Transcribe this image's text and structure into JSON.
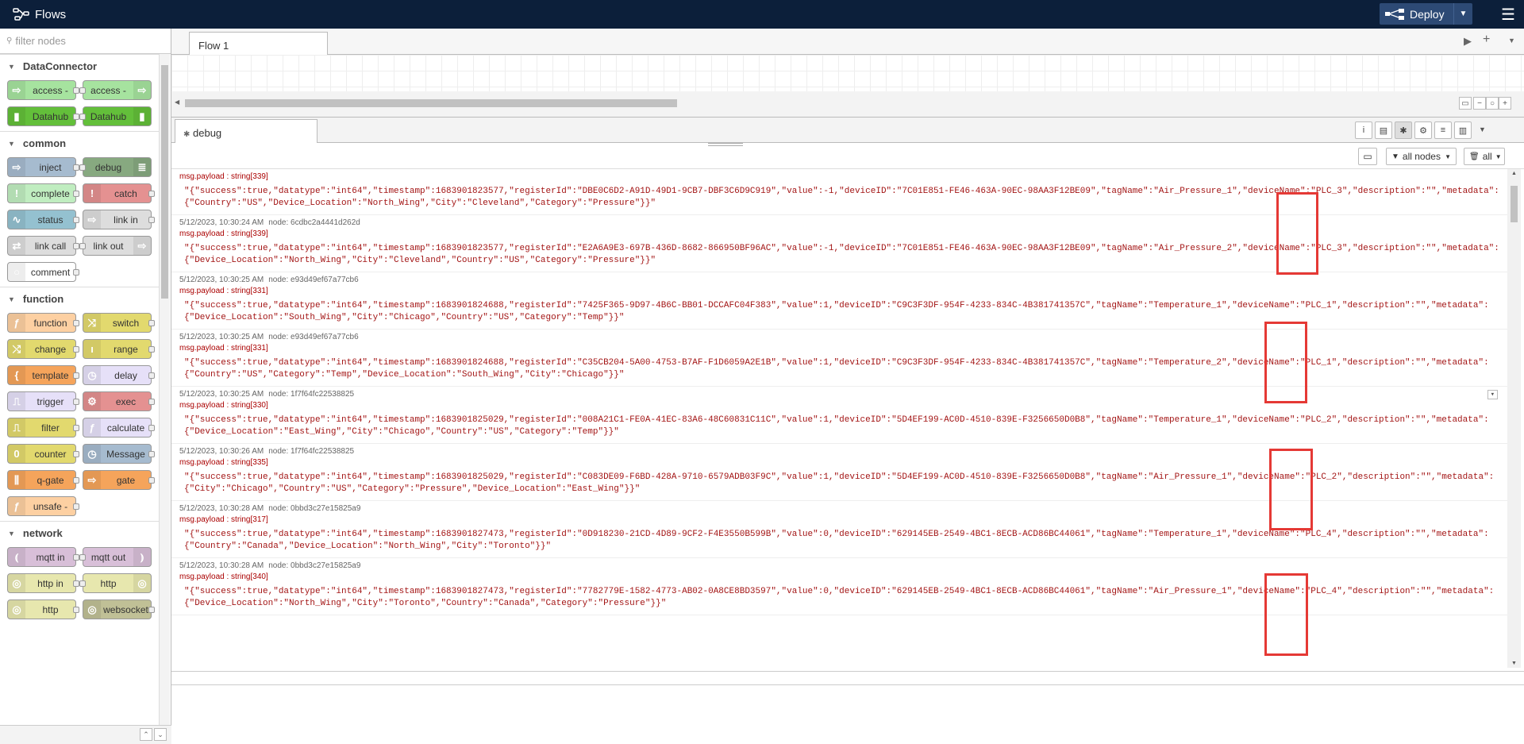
{
  "header": {
    "title": "Flows",
    "deploy_label": "Deploy"
  },
  "palette": {
    "search_placeholder": "filter nodes",
    "categories": [
      {
        "name": "DataConnector",
        "nodes": [
          {
            "label": "access -",
            "color": "#a6e39f",
            "icon": "⇨",
            "side": "l"
          },
          {
            "label": "access -",
            "color": "#a6e39f",
            "icon": "⇨",
            "side": "r"
          },
          {
            "label": "Datahub",
            "color": "#63bf3a",
            "icon": "▮",
            "side": "l"
          },
          {
            "label": "Datahub",
            "color": "#63bf3a",
            "icon": "▮",
            "side": "r"
          }
        ]
      },
      {
        "name": "common",
        "nodes": [
          {
            "label": "inject",
            "color": "#a6bbcf",
            "icon": "⇨",
            "side": "l"
          },
          {
            "label": "debug",
            "color": "#87a980",
            "icon": "≣",
            "side": "r"
          },
          {
            "label": "complete",
            "color": "#c0edc0",
            "icon": "!",
            "side": "l"
          },
          {
            "label": "catch",
            "color": "#e49191",
            "icon": "!",
            "side": "l"
          },
          {
            "label": "status",
            "color": "#94c1d0",
            "icon": "∿",
            "side": "l"
          },
          {
            "label": "link in",
            "color": "#dddddd",
            "icon": "⇨",
            "side": "l"
          },
          {
            "label": "link call",
            "color": "#dddddd",
            "icon": "⇄",
            "side": "l"
          },
          {
            "label": "link out",
            "color": "#dddddd",
            "icon": "⇨",
            "side": "r"
          },
          {
            "label": "comment",
            "color": "#ffffff",
            "icon": "○",
            "side": "l"
          }
        ]
      },
      {
        "name": "function",
        "nodes": [
          {
            "label": "function",
            "color": "#fdd0a2",
            "icon": "ƒ",
            "side": "l"
          },
          {
            "label": "switch",
            "color": "#e2d96e",
            "icon": "⤨",
            "side": "l"
          },
          {
            "label": "change",
            "color": "#e2d96e",
            "icon": "⤭",
            "side": "l"
          },
          {
            "label": "range",
            "color": "#e2d96e",
            "icon": "ı",
            "side": "l"
          },
          {
            "label": "template",
            "color": "#f5a45b",
            "icon": "{",
            "side": "l"
          },
          {
            "label": "delay",
            "color": "#e6e0f8",
            "icon": "◷",
            "side": "l"
          },
          {
            "label": "trigger",
            "color": "#e6e0f8",
            "icon": "⎍",
            "side": "l"
          },
          {
            "label": "exec",
            "color": "#e49191",
            "icon": "⚙",
            "side": "l"
          },
          {
            "label": "filter",
            "color": "#e2d96e",
            "icon": "⎍",
            "side": "l"
          },
          {
            "label": "calculate",
            "color": "#e6e0f8",
            "icon": "ƒ",
            "side": "l"
          },
          {
            "label": "counter",
            "color": "#e2d96e",
            "icon": "0",
            "side": "l"
          },
          {
            "label": "Message",
            "color": "#a6bbcf",
            "icon": "◷",
            "side": "l"
          },
          {
            "label": "q-gate",
            "color": "#f5a45b",
            "icon": "⫼",
            "side": "l"
          },
          {
            "label": "gate",
            "color": "#f5a45b",
            "icon": "⇨",
            "side": "l"
          },
          {
            "label": "unsafe -",
            "color": "#fdd0a2",
            "icon": "ƒ",
            "side": "l"
          }
        ]
      },
      {
        "name": "network",
        "nodes": [
          {
            "label": "mqtt in",
            "color": "#d8bfd8",
            "icon": "⦅",
            "side": "l"
          },
          {
            "label": "mqtt out",
            "color": "#d8bfd8",
            "icon": "⦆",
            "side": "r"
          },
          {
            "label": "http in",
            "color": "#e7e7ae",
            "icon": "◎",
            "side": "l"
          },
          {
            "label": "http",
            "color": "#e7e7ae",
            "icon": "◎",
            "side": "r"
          },
          {
            "label": "http",
            "color": "#e7e7ae",
            "icon": "◎",
            "side": "l"
          },
          {
            "label": "websocket",
            "color": "#c0c096",
            "icon": "◎",
            "side": "l"
          }
        ]
      }
    ]
  },
  "workspace": {
    "tabs": [
      {
        "label": "Flow 1"
      }
    ]
  },
  "sidebar": {
    "tab_label": "debug",
    "filter_label": "all nodes",
    "clear_label": "all"
  },
  "debug": {
    "messages": [
      {
        "time": "",
        "node": "",
        "topic": "msg.payload : string[339]",
        "line1": "\"{\"success\":true,\"datatype\":\"int64\",\"timestamp\":1683901823577,\"registerId\":\"DBE0C6D2-A91D-49D1-9CB7-DBF3C6D9C919\",\"value\":-1,\"deviceID\":\"7C01E851-FE46-463A-90EC-98AA3F12BE09\",\"tagName\":\"Air_Pressure_1\",\"deviceName\":\"PLC_3\",\"description\":\"\",\"metadata\":",
        "line2": "{\"Country\":\"US\",\"Device_Location\":\"North_Wing\",\"City\":\"Cleveland\",\"Category\":\"Pressure\"}}\""
      },
      {
        "time": "5/12/2023, 10:30:24 AM",
        "node": "node: 6cdbc2a4441d262d",
        "topic": "msg.payload : string[339]",
        "line1": "\"{\"success\":true,\"datatype\":\"int64\",\"timestamp\":1683901823577,\"registerId\":\"E2A6A9E3-697B-436D-8682-866950BF96AC\",\"value\":-1,\"deviceID\":\"7C01E851-FE46-463A-90EC-98AA3F12BE09\",\"tagName\":\"Air_Pressure_2\",\"deviceName\":\"PLC_3\",\"description\":\"\",\"metadata\":",
        "line2": "{\"Device_Location\":\"North_Wing\",\"City\":\"Cleveland\",\"Country\":\"US\",\"Category\":\"Pressure\"}}\""
      },
      {
        "time": "5/12/2023, 10:30:25 AM",
        "node": "node: e93d49ef67a77cb6",
        "topic": "msg.payload : string[331]",
        "line1": "\"{\"success\":true,\"datatype\":\"int64\",\"timestamp\":1683901824688,\"registerId\":\"7425F365-9D97-4B6C-BB01-DCCAFC04F383\",\"value\":1,\"deviceID\":\"C9C3F3DF-954F-4233-834C-4B381741357C\",\"tagName\":\"Temperature_1\",\"deviceName\":\"PLC_1\",\"description\":\"\",\"metadata\":",
        "line2": "{\"Device_Location\":\"South_Wing\",\"City\":\"Chicago\",\"Country\":\"US\",\"Category\":\"Temp\"}}\""
      },
      {
        "time": "5/12/2023, 10:30:25 AM",
        "node": "node: e93d49ef67a77cb6",
        "topic": "msg.payload : string[331]",
        "line1": "\"{\"success\":true,\"datatype\":\"int64\",\"timestamp\":1683901824688,\"registerId\":\"C35CB204-5A00-4753-B7AF-F1D6059A2E1B\",\"value\":1,\"deviceID\":\"C9C3F3DF-954F-4233-834C-4B381741357C\",\"tagName\":\"Temperature_2\",\"deviceName\":\"PLC_1\",\"description\":\"\",\"metadata\":",
        "line2": "{\"Country\":\"US\",\"Category\":\"Temp\",\"Device_Location\":\"South_Wing\",\"City\":\"Chicago\"}}\""
      },
      {
        "time": "5/12/2023, 10:30:25 AM",
        "node": "node: 1f7f64fc22538825",
        "topic": "msg.payload : string[330]",
        "line1": "\"{\"success\":true,\"datatype\":\"int64\",\"timestamp\":1683901825029,\"registerId\":\"008A21C1-FE0A-41EC-83A6-48C60831C11C\",\"value\":1,\"deviceID\":\"5D4EF199-AC0D-4510-839E-F3256650D0B8\",\"tagName\":\"Temperature_1\",\"deviceName\":\"PLC_2\",\"description\":\"\",\"metadata\":",
        "line2": "{\"Device_Location\":\"East_Wing\",\"City\":\"Chicago\",\"Country\":\"US\",\"Category\":\"Temp\"}}\""
      },
      {
        "time": "5/12/2023, 10:30:26 AM",
        "node": "node: 1f7f64fc22538825",
        "topic": "msg.payload : string[335]",
        "line1": "\"{\"success\":true,\"datatype\":\"int64\",\"timestamp\":1683901825029,\"registerId\":\"C083DE09-F6BD-428A-9710-6579ADB03F9C\",\"value\":1,\"deviceID\":\"5D4EF199-AC0D-4510-839E-F3256650D0B8\",\"tagName\":\"Air_Pressure_1\",\"deviceName\":\"PLC_2\",\"description\":\"\",\"metadata\":",
        "line2": "{\"City\":\"Chicago\",\"Country\":\"US\",\"Category\":\"Pressure\",\"Device_Location\":\"East_Wing\"}}\""
      },
      {
        "time": "5/12/2023, 10:30:28 AM",
        "node": "node: 0bbd3c27e15825a9",
        "topic": "msg.payload : string[317]",
        "line1": "\"{\"success\":true,\"datatype\":\"int64\",\"timestamp\":1683901827473,\"registerId\":\"0D918230-21CD-4D89-9CF2-F4E3550B599B\",\"value\":0,\"deviceID\":\"629145EB-2549-4BC1-8ECB-ACD86BC44061\",\"tagName\":\"Temperature_1\",\"deviceName\":\"PLC_4\",\"description\":\"\",\"metadata\":",
        "line2": "{\"Country\":\"Canada\",\"Device_Location\":\"North_Wing\",\"City\":\"Toronto\"}}\""
      },
      {
        "time": "5/12/2023, 10:30:28 AM",
        "node": "node: 0bbd3c27e15825a9",
        "topic": "msg.payload : string[340]",
        "line1": "\"{\"success\":true,\"datatype\":\"int64\",\"timestamp\":1683901827473,\"registerId\":\"7782779E-1582-4773-AB02-0A8CE8BD3597\",\"value\":0,\"deviceID\":\"629145EB-2549-4BC1-8ECB-ACD86BC44061\",\"tagName\":\"Air_Pressure_1\",\"deviceName\":\"PLC_4\",\"description\":\"\",\"metadata\":",
        "line2": "{\"Device_Location\":\"North_Wing\",\"City\":\"Toronto\",\"Country\":\"Canada\",\"Category\":\"Pressure\"}}\""
      }
    ]
  },
  "colors": {
    "header_bg": "#0c1f3a",
    "deploy_bg": "#2d4a75",
    "highlight": "#e53935",
    "payload": "#a31515"
  }
}
